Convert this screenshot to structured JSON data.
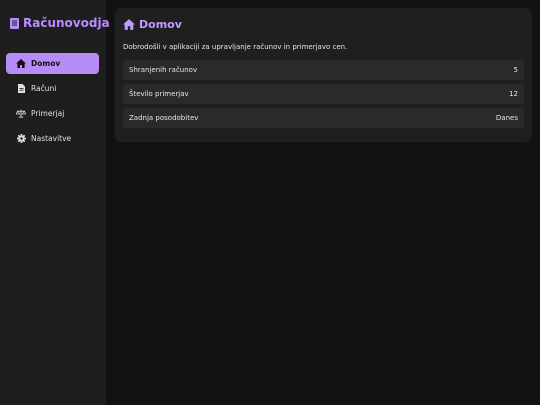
{
  "app": {
    "title": "Računovodja"
  },
  "sidebar": {
    "items": [
      {
        "label": "Domov",
        "icon": "home-icon",
        "active": true
      },
      {
        "label": "Računi",
        "icon": "document-icon",
        "active": false
      },
      {
        "label": "Primerjaj",
        "icon": "scale-icon",
        "active": false
      },
      {
        "label": "Nastavitve",
        "icon": "gear-icon",
        "active": false
      }
    ]
  },
  "main": {
    "title": "Domov",
    "welcome": "Dobrodošli v aplikaciji za upravljanje računov in primerjavo cen.",
    "stats": [
      {
        "label": "Shranjenih računov",
        "value": "5"
      },
      {
        "label": "Število primerjav",
        "value": "12"
      },
      {
        "label": "Zadnja posodobitev",
        "value": "Danes"
      }
    ]
  },
  "colors": {
    "accent": "#b78cf8",
    "background": "#121212",
    "sidebar": "#1e1e1e",
    "card": "#1f1f1f",
    "row": "#2a2a2a"
  }
}
